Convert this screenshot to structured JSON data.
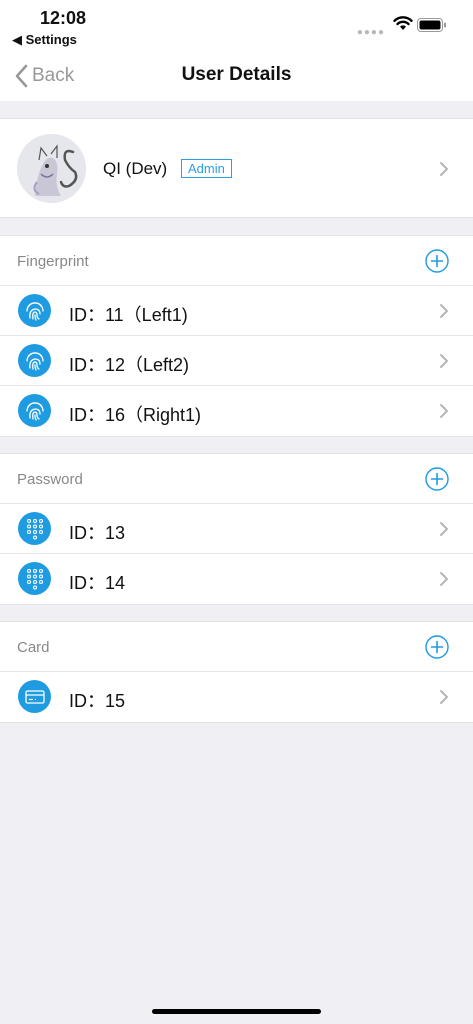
{
  "status_bar": {
    "time": "12:08",
    "back_app": "◀ Settings"
  },
  "nav": {
    "back_label": "Back",
    "title": "User Details"
  },
  "profile": {
    "name": "QI (Dev)",
    "role_badge": "Admin"
  },
  "sections": {
    "fingerprint": {
      "title": "Fingerprint",
      "items": [
        {
          "label": "ID：11（Left1)"
        },
        {
          "label": "ID：12（Left2)"
        },
        {
          "label": "ID：16（Right1)"
        }
      ]
    },
    "password": {
      "title": "Password",
      "items": [
        {
          "label": "ID：13"
        },
        {
          "label": "ID：14"
        }
      ]
    },
    "card": {
      "title": "Card",
      "items": [
        {
          "label": "ID：15"
        }
      ]
    }
  },
  "colors": {
    "accent": "#1e9be1",
    "background": "#efeff4",
    "muted_text": "#888888"
  },
  "icons": {
    "fingerprint": "fingerprint-icon",
    "password": "keypad-icon",
    "card": "card-icon",
    "add": "plus-circle-icon",
    "row_arrow": "chevron-right-icon"
  }
}
